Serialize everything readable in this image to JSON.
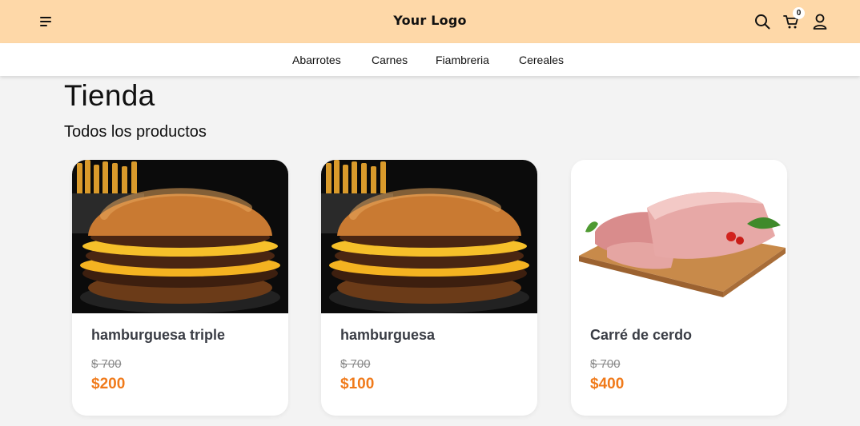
{
  "header": {
    "logo": "Your Logo",
    "cart_count": "0",
    "menu_icon": "menu-icon",
    "search_icon": "search-icon",
    "cart_icon": "cart-icon",
    "user_icon": "user-icon",
    "background": "#fed8a8"
  },
  "categories": [
    "Abarrotes",
    "Carnes",
    "Fiambreria",
    "Cereales"
  ],
  "page": {
    "title": "Tienda",
    "subtitle": "Todos los productos"
  },
  "products": [
    {
      "name": "hamburguesa triple",
      "old_price": "$ 700",
      "price": "$200",
      "image": "burger-image"
    },
    {
      "name": "hamburguesa",
      "old_price": "$ 700",
      "price": "$100",
      "image": "burger-image"
    },
    {
      "name": "Carré de cerdo",
      "old_price": "$ 700",
      "price": "$400",
      "image": "pork-loin-image"
    }
  ],
  "colors": {
    "accent": "#f07a1a"
  }
}
